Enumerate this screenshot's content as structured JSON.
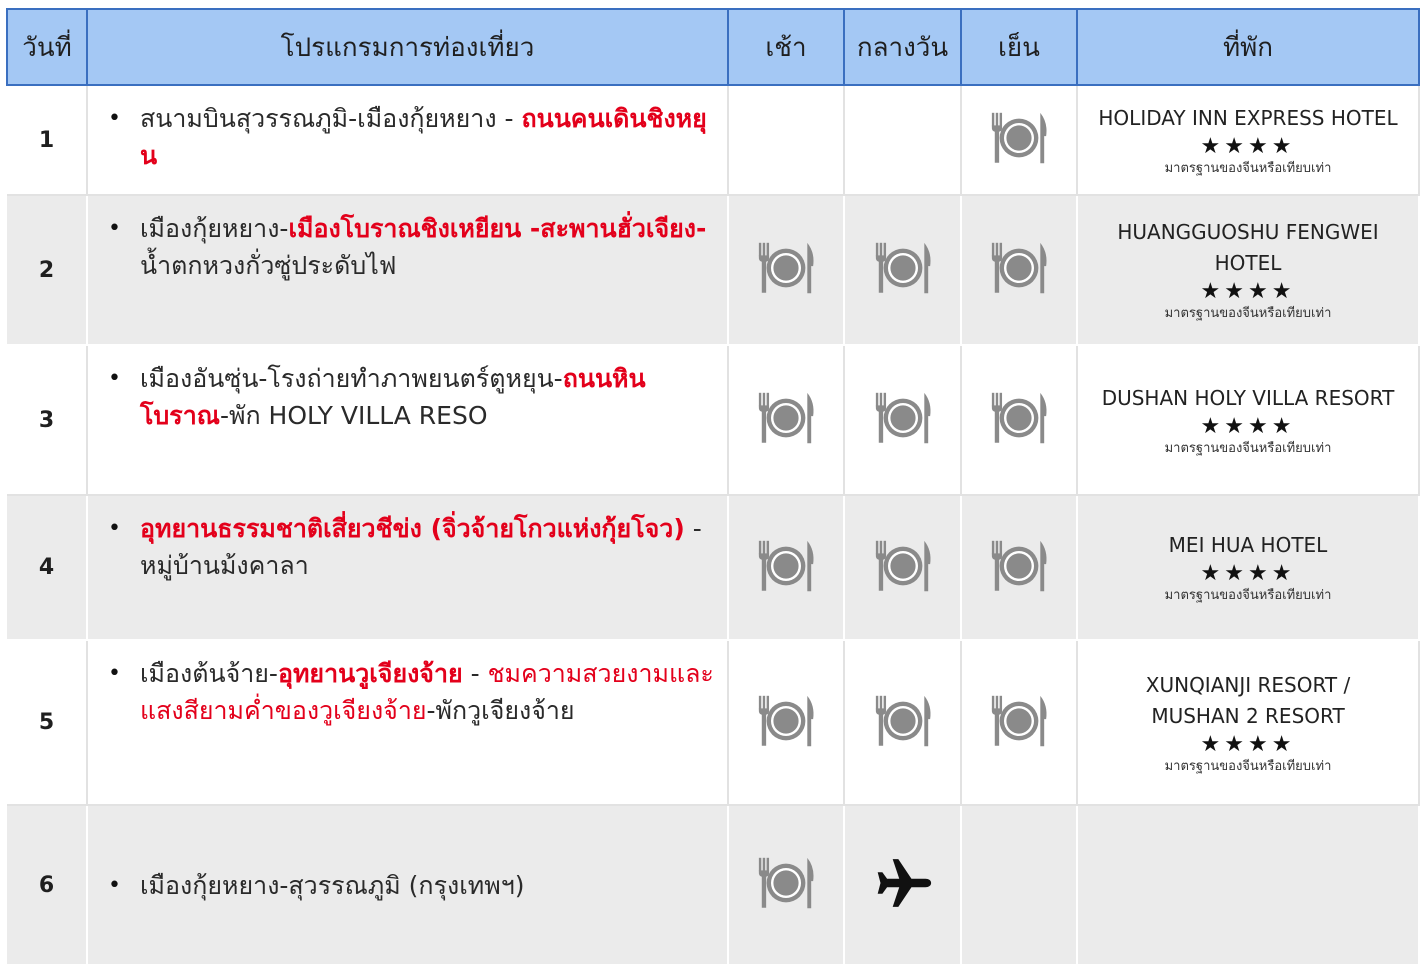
{
  "header": {
    "day": "วันที่",
    "program": "โปรแกรมการท่องเที่ยว",
    "breakfast": "เช้า",
    "lunch": "กลางวัน",
    "dinner": "เย็น",
    "hotel": "ที่พัก"
  },
  "hotel_stars": "★★★★",
  "hotel_standard": "มาตรฐานของจีนหรือเทียบเท่า",
  "meal_icon": "plate-fork-knife-icon",
  "flight_icon": "airplane-icon",
  "colors": {
    "header_bg": "#a4c8f4",
    "header_border": "#3a6fc0",
    "highlight": "#e3001b",
    "row_alt": "#ebebeb",
    "icon_gray": "#8a8a8a"
  },
  "days": [
    {
      "day": "1",
      "program": [
        {
          "text": "สนามบินสุวรรณภูมิ-เมืองกุ้ยหยาง - ",
          "style": "normal"
        },
        {
          "text": "ถนนคนเดินชิงหยุน",
          "style": "highlight"
        }
      ],
      "breakfast": "",
      "lunch": "",
      "dinner": "meal",
      "hotel": [
        "HOLIDAY INN EXPRESS HOTEL"
      ]
    },
    {
      "day": "2",
      "program": [
        {
          "text": "เมืองกุ้ยหยาง-",
          "style": "normal"
        },
        {
          "text": "เมืองโบราณชิงเหยียน -สะพานฮั่วเจียง-",
          "style": "highlight"
        },
        {
          "text": "น้ำตกหวงกั่วซู่ประดับไฟ",
          "style": "normal"
        }
      ],
      "breakfast": "meal",
      "lunch": "meal",
      "dinner": "meal",
      "hotel": [
        "HUANGGUOSHU FENGWEI",
        "HOTEL"
      ]
    },
    {
      "day": "3",
      "program": [
        {
          "text": "เมืองอันซุ่น-โรงถ่ายทำภาพยนตร์ตูหยุน-",
          "style": "normal"
        },
        {
          "text": "ถนนหินโบราณ",
          "style": "highlight"
        },
        {
          "text": "-พัก HOLY VILLA RESO",
          "style": "normal"
        }
      ],
      "breakfast": "meal",
      "lunch": "meal",
      "dinner": "meal",
      "hotel": [
        "DUSHAN HOLY VILLA RESORT"
      ]
    },
    {
      "day": "4",
      "program": [
        {
          "text": "อุทยานธรรมชาติเสี่ยวชีข่ง (จิ่วจ้ายโกวแห่งกุ้ยโจว)",
          "style": "highlight"
        },
        {
          "text": " - หมู่บ้านม้งคาลา",
          "style": "normal"
        }
      ],
      "breakfast": "meal",
      "lunch": "meal",
      "dinner": "meal",
      "hotel": [
        "MEI HUA HOTEL"
      ]
    },
    {
      "day": "5",
      "program": [
        {
          "text": "เมืองต้นจ้าย-",
          "style": "normal"
        },
        {
          "text": "อุทยานวูเจียงจ้าย",
          "style": "highlight"
        },
        {
          "text": " - ",
          "style": "normal"
        },
        {
          "text": "ชมความสวยงามและแสงสียามค่ำของวูเจียงจ้าย",
          "style": "red"
        },
        {
          "text": "-พักวูเจียงจ้าย",
          "style": "normal"
        }
      ],
      "breakfast": "meal",
      "lunch": "meal",
      "dinner": "meal",
      "hotel": [
        "XUNQIANJI RESORT /",
        "MUSHAN 2 RESORT"
      ]
    },
    {
      "day": "6",
      "program": [
        {
          "text": "เมืองกุ้ยหยาง-สุวรรณภูมิ (กรุงเทพฯ)",
          "style": "normal"
        }
      ],
      "breakfast": "meal",
      "lunch": "flight",
      "dinner": "",
      "hotel": []
    }
  ]
}
